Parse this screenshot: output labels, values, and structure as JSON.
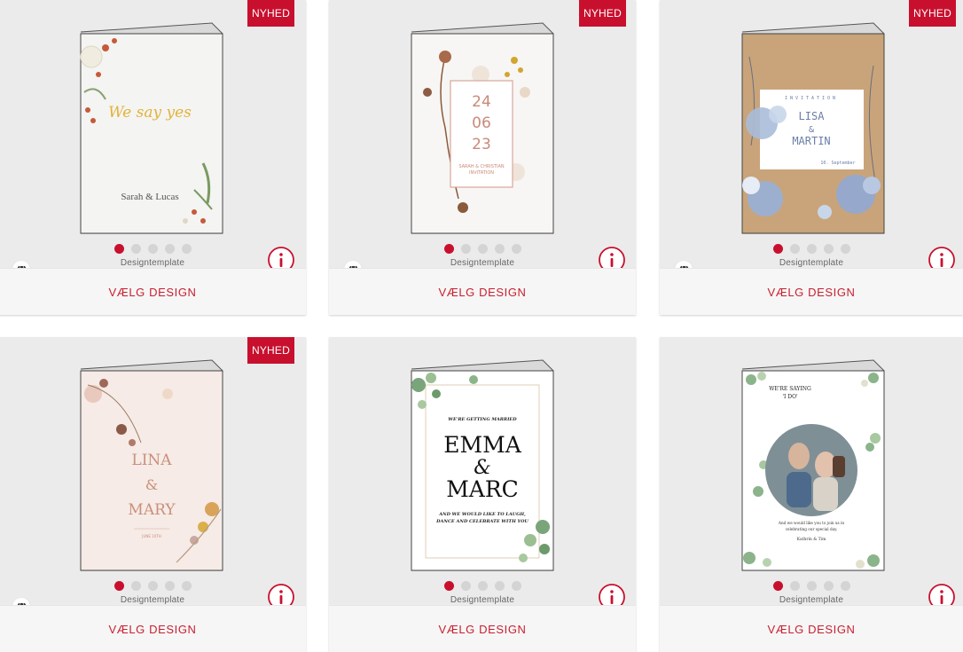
{
  "colors": {
    "accent": "#c8102e",
    "tile_bg": "#ebebeb",
    "footer_bg": "#f6f6f6"
  },
  "icons": {
    "gem": "diamond-icon",
    "info": "info-icon"
  },
  "products": [
    {
      "badge": "NYHED",
      "card_text": {
        "script": "We say yes",
        "names": "Sarah & Lucas"
      },
      "template_label": "Designtemplate",
      "choose_label": "VÆLG DESIGN"
    },
    {
      "badge": "NYHED",
      "card_text": {
        "day": "24",
        "month": "06",
        "year": "23",
        "line1": "SARAH & CHRISTIAN",
        "line2": "INVITATION"
      },
      "template_label": "Designtemplate",
      "choose_label": "VÆLG DESIGN"
    },
    {
      "badge": "NYHED",
      "card_text": {
        "heading": "INVITATION",
        "name1": "LISA",
        "amp": "&",
        "name2": "MARTIN",
        "date": "10. September"
      },
      "template_label": "Designtemplate",
      "choose_label": "VÆLG DESIGN"
    },
    {
      "badge": "NYHED",
      "card_text": {
        "name1": "LINA",
        "amp": "&",
        "name2": "MARY",
        "date": "JUNE 10TH"
      },
      "template_label": "Designtemplate",
      "choose_label": "VÆLG DESIGN"
    },
    {
      "badge": "",
      "card_text": {
        "intro": "WE'RE GETTING MARRIED",
        "name1": "EMMA",
        "amp": "&",
        "name2": "MARC",
        "outro1": "AND WE WOULD LIKE TO LAUGH,",
        "outro2": "DANCE AND CELEBRATE WITH YOU"
      },
      "template_label": "Designtemplate",
      "choose_label": "VÆLG DESIGN"
    },
    {
      "badge": "",
      "card_text": {
        "heading1": "WE'RE SAYING",
        "heading2": "'I DO'",
        "body1": "And we would like you to join us in",
        "body2": "celebrating our special day.",
        "names": "Kathrin & Tim"
      },
      "template_label": "Designtemplate",
      "choose_label": "VÆLG DESIGN"
    }
  ]
}
